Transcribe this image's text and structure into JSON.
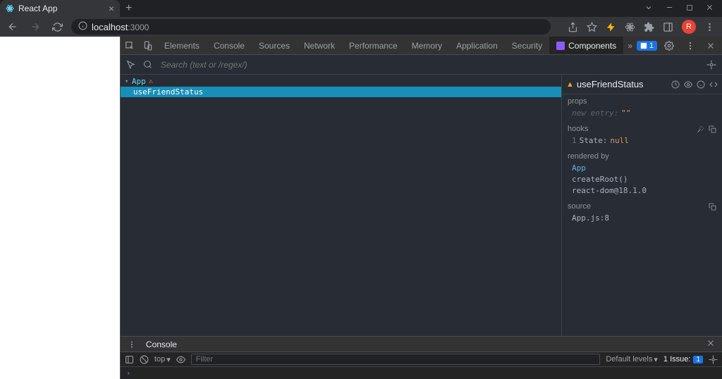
{
  "browser": {
    "tab_title": "React App",
    "url_host": "localhost",
    "url_port": ":3000",
    "profile_letter": "R"
  },
  "devtools": {
    "tabs": {
      "elements": "Elements",
      "console": "Console",
      "sources": "Sources",
      "network": "Network",
      "performance": "Performance",
      "memory": "Memory",
      "application": "Application",
      "security": "Security",
      "components": "Components"
    },
    "errors_count": "1",
    "search_placeholder": "Search (text or /regex/)"
  },
  "tree": {
    "root": "App",
    "child": "useFriendStatus"
  },
  "details": {
    "component_name": "useFriendStatus",
    "sections": {
      "props": "props",
      "hooks": "hooks",
      "rendered_by": "rendered by",
      "source": "source"
    },
    "props_new": "new entry:",
    "props_new_val": "\"\"",
    "hooks_idx": "1",
    "hooks_key": "State:",
    "hooks_val": "null",
    "rendered": {
      "app": "App",
      "create_root": "createRoot()",
      "react_dom": "react-dom@18.1.0"
    },
    "source_val": "App.js:8"
  },
  "console": {
    "tab_label": "Console",
    "top": "top",
    "filter_placeholder": "Filter",
    "levels": "Default levels",
    "issue_label": "1 Issue:",
    "issue_count": "1"
  }
}
